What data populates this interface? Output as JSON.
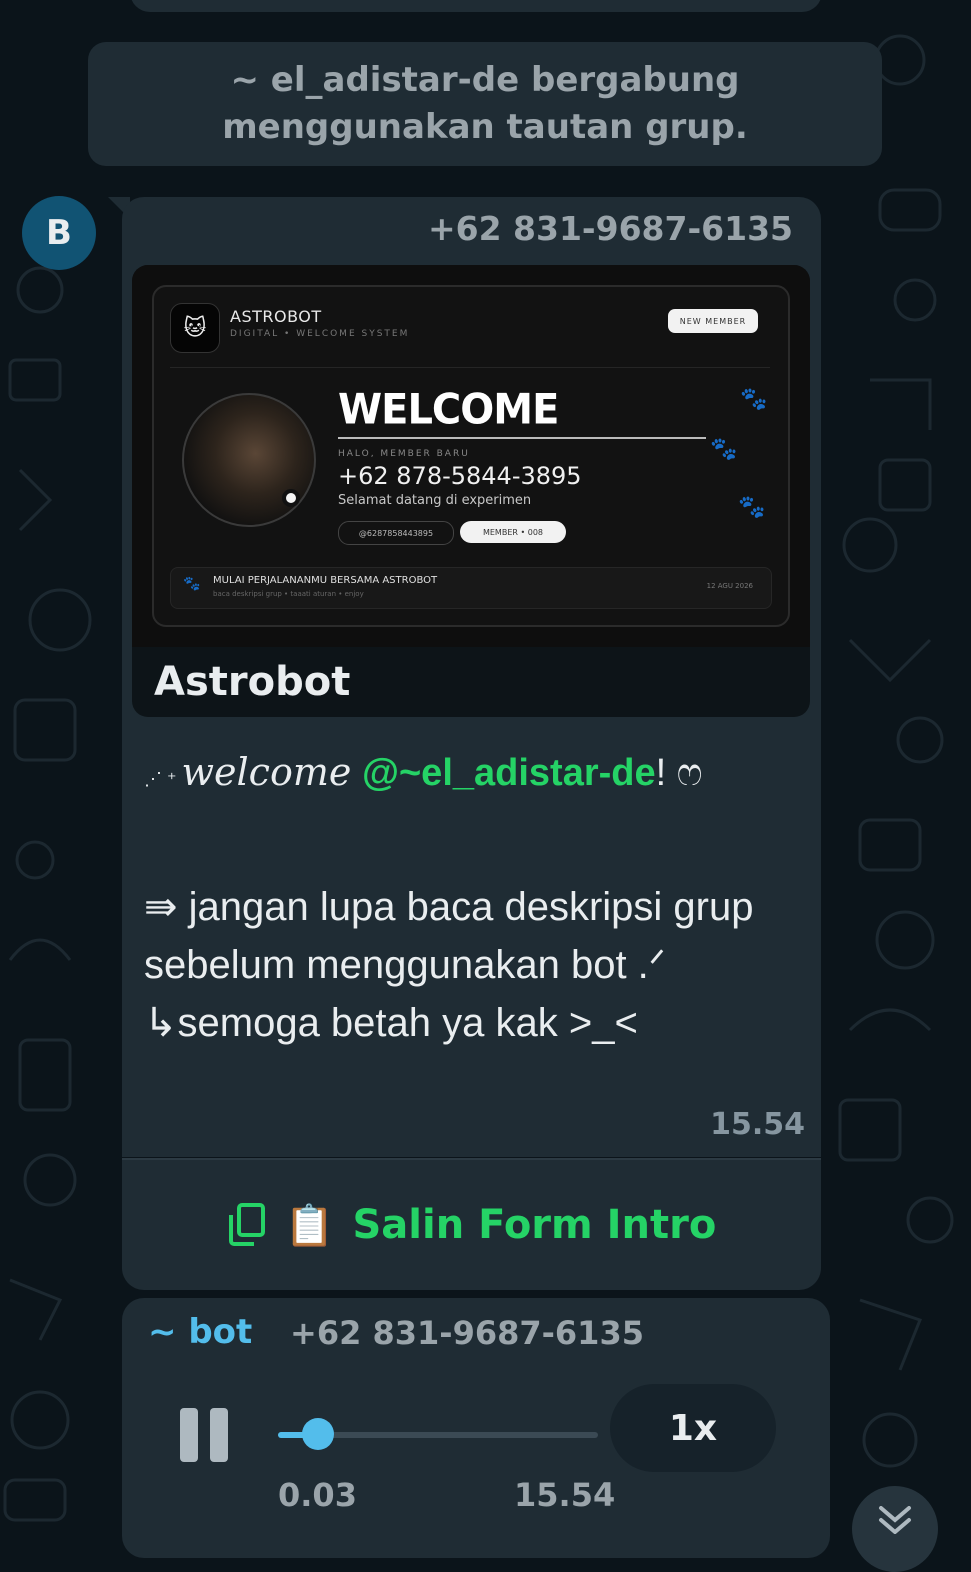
{
  "system_message": "~ el_adistar-de bergabung menggunakan tautan grup.",
  "avatar_letter": "B",
  "message": {
    "sender_phone": "+62 831-9687-6135",
    "preview": {
      "card": {
        "brand": "ASTROBOT",
        "brand_sub": "DIGITAL  •  WELCOME SYSTEM",
        "badge": "NEW MEMBER",
        "title": "WELCOME",
        "halo": "HALO, MEMBER BARU",
        "phone": "+62 878-5844-3895",
        "desc": "Selamat datang di experimen",
        "tag_id": "@6287858443895",
        "tag_member": "MEMBER • 008",
        "footer_text": "MULAI PERJALANANMU BERSAMA ASTROBOT",
        "footer_sub": "baca deskripsi grup • taaati aturan • enjoy",
        "footer_date": "12 AGU 2026"
      },
      "title": "Astrobot"
    },
    "welcome_prefix": "welcome",
    "mention": "@~el_adistar-de",
    "welcome_suffix": "! ෆ",
    "line1": "⇛ jangan lupa baca deskripsi grup sebelum menggunakan bot .ᐟ",
    "line2": "↳semoga betah ya kak >_<",
    "time": "15.54"
  },
  "button": {
    "emoji": "📋",
    "label": "Salin Form Intro"
  },
  "audio": {
    "sender": "~ bot",
    "phone": "+62 831-9687-6135",
    "current_time": "0.03",
    "duration": "15.54",
    "progress": 0.1,
    "speed": "1x"
  },
  "colors": {
    "accent_green": "#25d366",
    "accent_blue": "#53bdeb",
    "bubble_bg": "#1f2c34",
    "chat_bg": "#0b141a"
  },
  "icons": [
    "copy-icon",
    "pause-icon",
    "chevron-down-icon",
    "paw-icon"
  ]
}
